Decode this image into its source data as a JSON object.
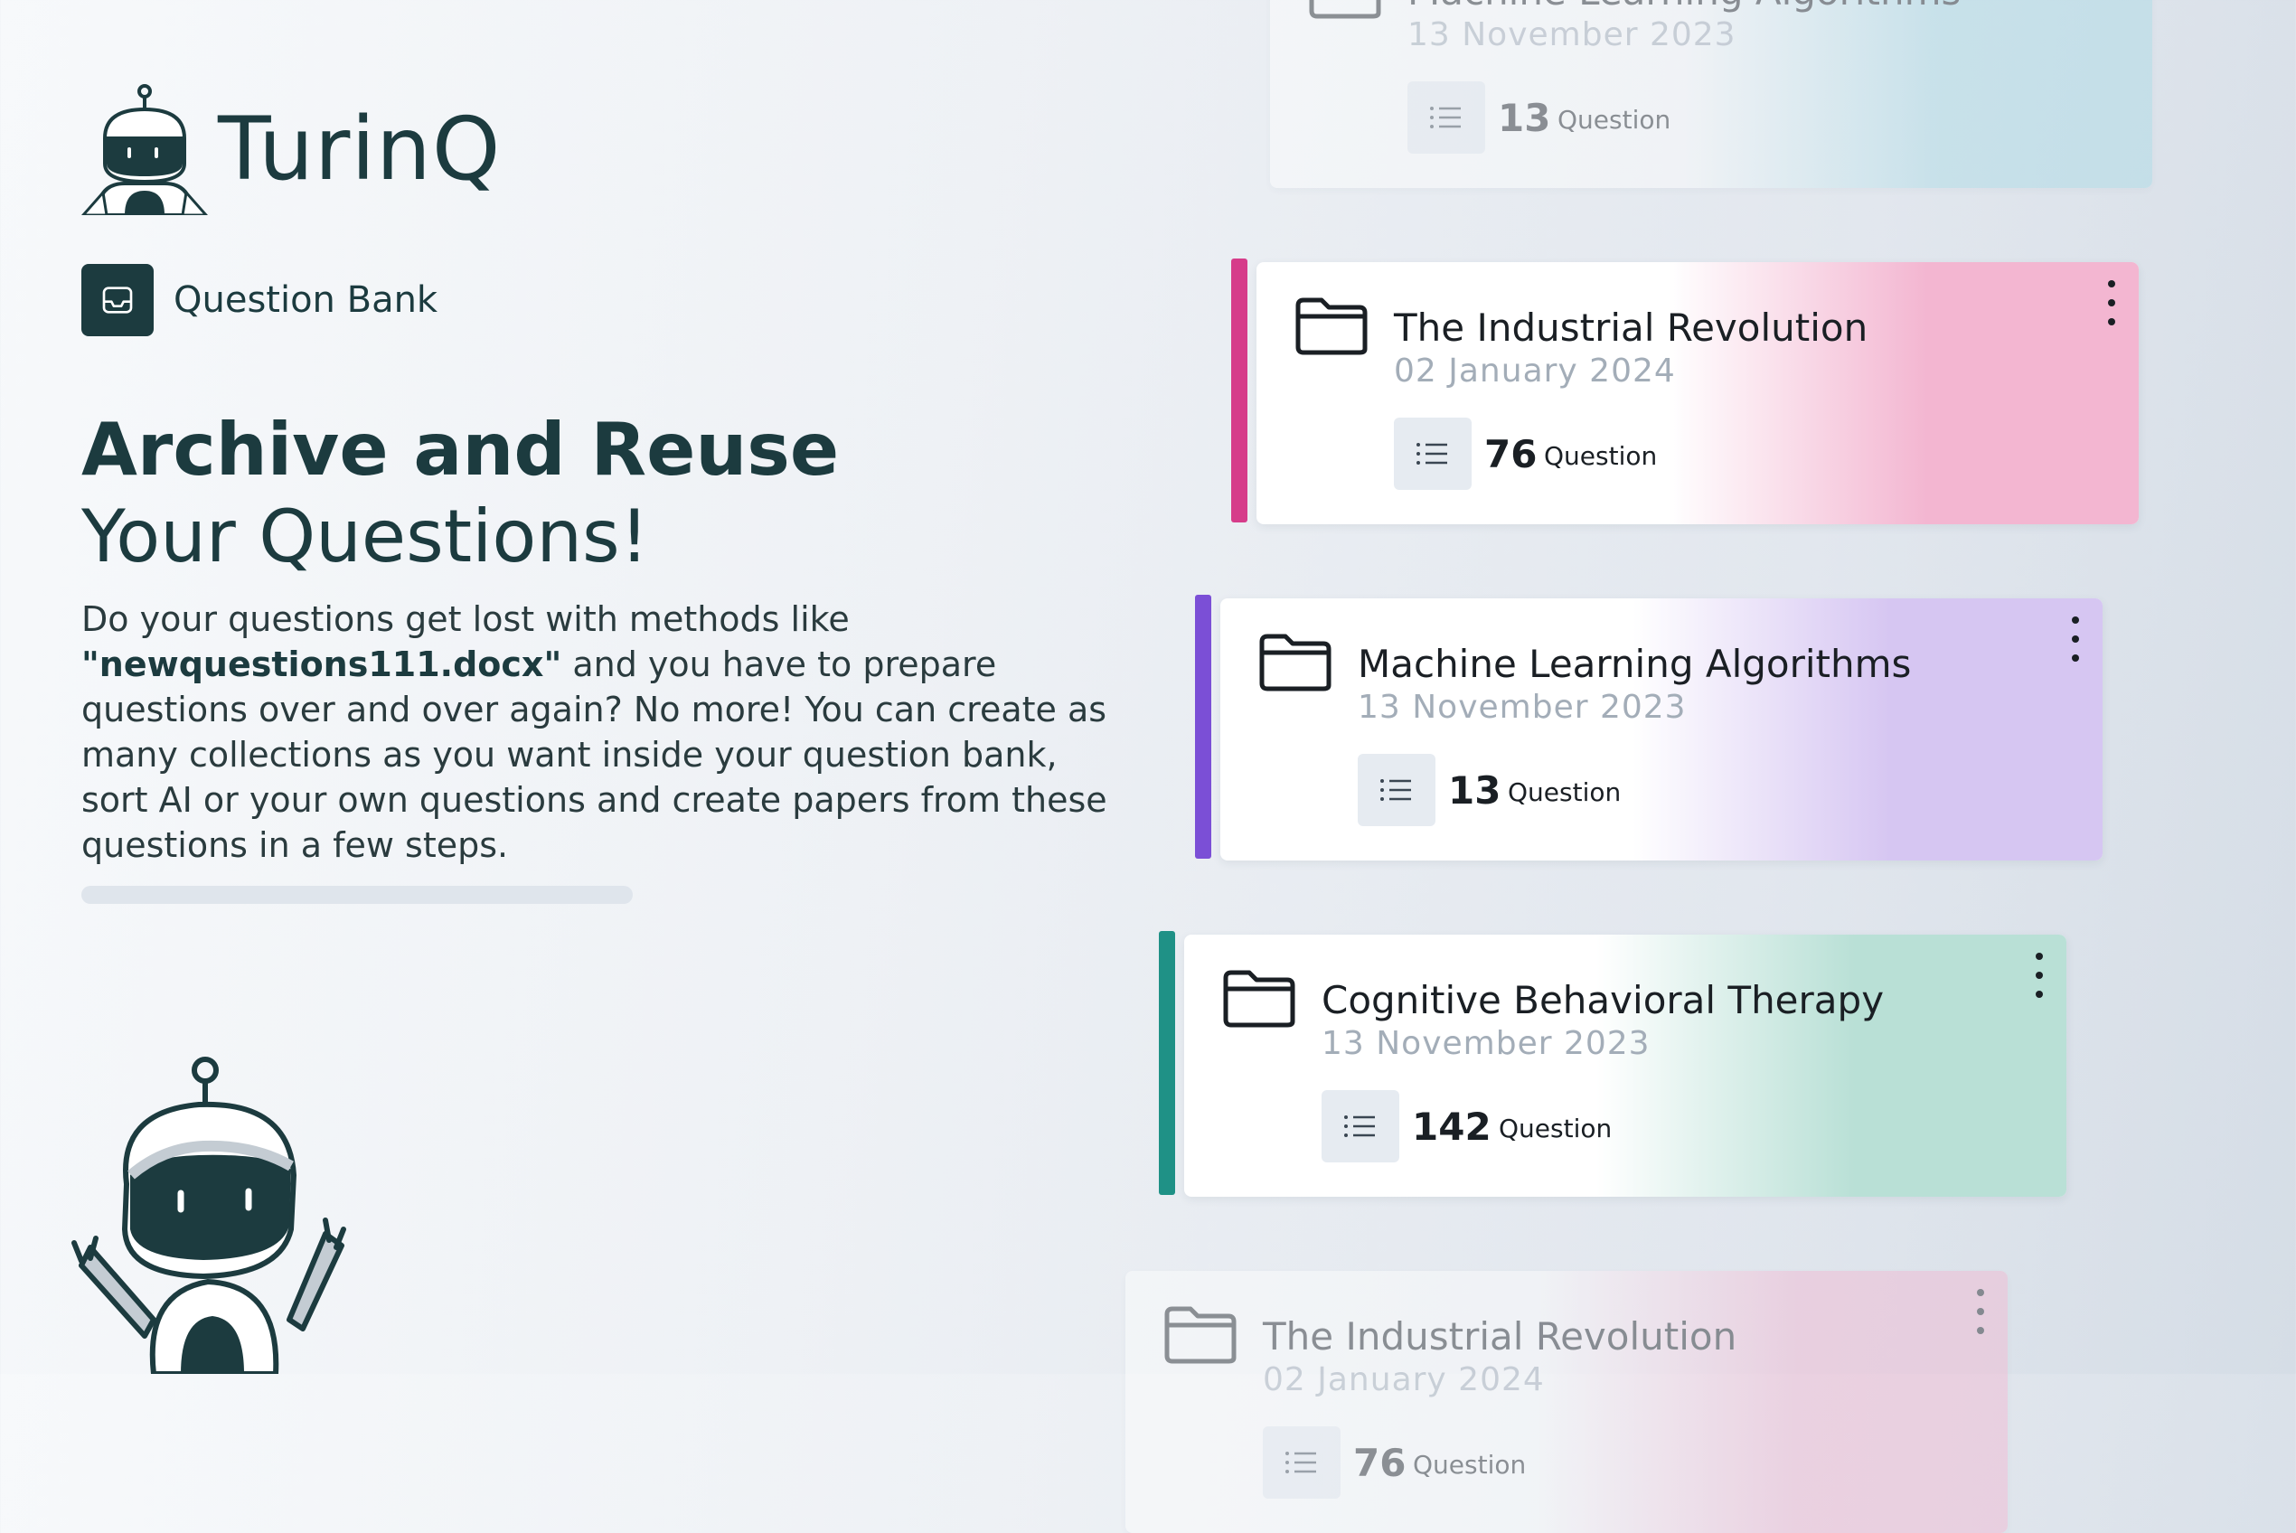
{
  "brand": {
    "name": "TurinQ"
  },
  "section": {
    "label": "Question Bank",
    "icon": "inbox-icon"
  },
  "hero": {
    "title_bold": "Archive and Reuse",
    "title_regular": "Your Questions!",
    "desc_part1": "Do your questions get lost with methods like ",
    "desc_highlight": "\"newquestions111.docx\"",
    "desc_part2": " and you have to prepare questions over and over again? No more! You can create as many collections as you want inside your question bank, sort AI or your own questions and create papers from these questions in a few steps."
  },
  "question_label": "Question",
  "collections": [
    {
      "title": "Machine Learning Algorithms",
      "date": "13 November 2023",
      "count": "13",
      "accent": "#7b4fd6",
      "glow": "#a9dbe6"
    },
    {
      "title": "The Industrial Revolution",
      "date": "02 January 2024",
      "count": "76",
      "accent": "#d63c8a",
      "glow": "#f3b6d1"
    },
    {
      "title": "Machine Learning Algorithms",
      "date": "13 November 2023",
      "count": "13",
      "accent": "#7b4fd6",
      "glow": "#d6c6f2"
    },
    {
      "title": "Cognitive Behavioral Therapy",
      "date": "13 November 2023",
      "count": "142",
      "accent": "#1f9186",
      "glow": "#b9e0d6"
    },
    {
      "title": "The Industrial Revolution",
      "date": "02 January 2024",
      "count": "76",
      "accent": "#d63c8a",
      "glow": "#f3b6d1"
    }
  ]
}
